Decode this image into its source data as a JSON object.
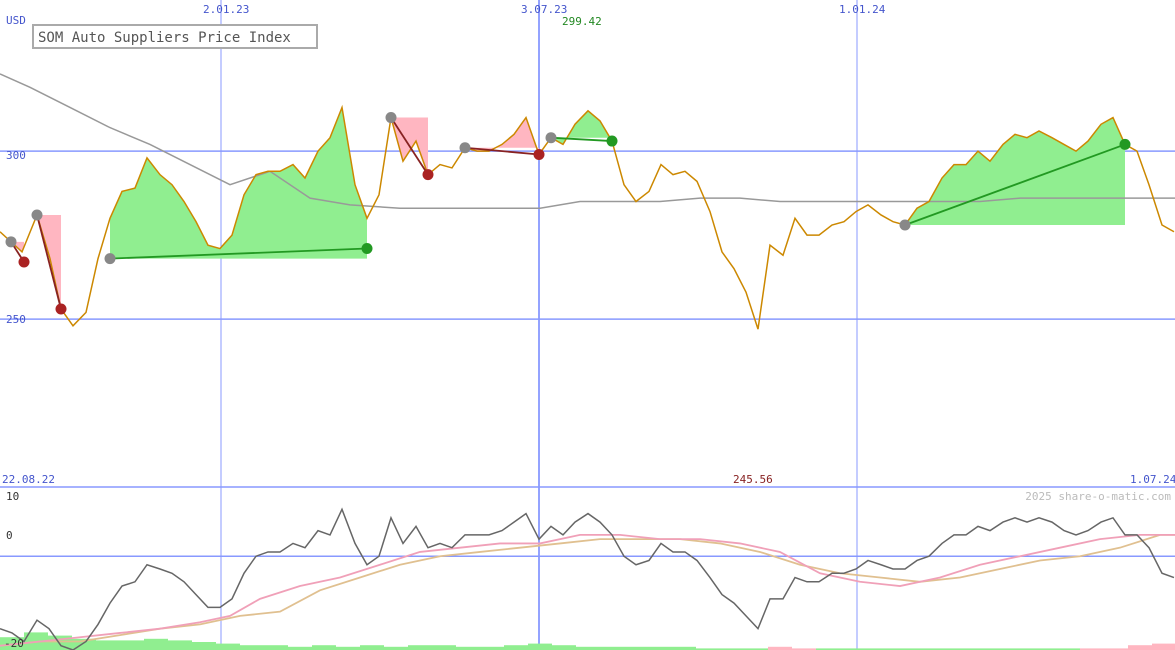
{
  "chart_data": [
    {
      "type": "line",
      "title": "SOM Auto Suppliers Price Index",
      "ylabel": "USD",
      "ylim": [
        200,
        345
      ],
      "y_ticks": [
        "300",
        "250"
      ],
      "x_ticks": [
        "2.01.23",
        "3.07.23",
        "1.01.24"
      ],
      "x_start_label": "22.08.22",
      "x_end_label": "1.07.24",
      "high_label": "299.42",
      "low_label": "245.56",
      "grid": true,
      "colors": {
        "price": "#cc8800",
        "average": "#999999",
        "gain_fill": "#90ee90",
        "loss_fill": "#ffb6c1",
        "gain_line": "#229922",
        "loss_line": "#882222",
        "grid": "#8899ff"
      },
      "price_series": [
        [
          0,
          276
        ],
        [
          11,
          273
        ],
        [
          22,
          270
        ],
        [
          37,
          281
        ],
        [
          50,
          268
        ],
        [
          61,
          253
        ],
        [
          73,
          248
        ],
        [
          86,
          252
        ],
        [
          98,
          268
        ],
        [
          110,
          280
        ],
        [
          122,
          288
        ],
        [
          135,
          289
        ],
        [
          147,
          298
        ],
        [
          160,
          293
        ],
        [
          172,
          290
        ],
        [
          184,
          285
        ],
        [
          196,
          279
        ],
        [
          208,
          272
        ],
        [
          220,
          271
        ],
        [
          232,
          275
        ],
        [
          244,
          287
        ],
        [
          256,
          293
        ],
        [
          268,
          294
        ],
        [
          280,
          294
        ],
        [
          293,
          296
        ],
        [
          305,
          292
        ],
        [
          318,
          300
        ],
        [
          330,
          304
        ],
        [
          342,
          313
        ],
        [
          355,
          290
        ],
        [
          367,
          280
        ],
        [
          379,
          287
        ],
        [
          391,
          310
        ],
        [
          403,
          297
        ],
        [
          416,
          303
        ],
        [
          428,
          293
        ],
        [
          440,
          296
        ],
        [
          452,
          295
        ],
        [
          465,
          301
        ],
        [
          477,
          300
        ],
        [
          489,
          300
        ],
        [
          502,
          302
        ],
        [
          514,
          305
        ],
        [
          526,
          310
        ],
        [
          539,
          299
        ],
        [
          551,
          304
        ],
        [
          563,
          302
        ],
        [
          575,
          308
        ],
        [
          588,
          312
        ],
        [
          600,
          309
        ],
        [
          612,
          303
        ],
        [
          624,
          290
        ],
        [
          636,
          285
        ],
        [
          649,
          288
        ],
        [
          661,
          296
        ],
        [
          673,
          293
        ],
        [
          685,
          294
        ],
        [
          697,
          291
        ],
        [
          710,
          282
        ],
        [
          722,
          270
        ],
        [
          734,
          265
        ],
        [
          746,
          258
        ],
        [
          758,
          247
        ],
        [
          770,
          272
        ],
        [
          783,
          269
        ],
        [
          795,
          280
        ],
        [
          807,
          275
        ],
        [
          819,
          275
        ],
        [
          832,
          278
        ],
        [
          844,
          279
        ],
        [
          856,
          282
        ],
        [
          868,
          284
        ],
        [
          881,
          281
        ],
        [
          893,
          279
        ],
        [
          905,
          278
        ],
        [
          917,
          283
        ],
        [
          929,
          285
        ],
        [
          942,
          292
        ],
        [
          954,
          296
        ],
        [
          966,
          296
        ],
        [
          978,
          300
        ],
        [
          990,
          297
        ],
        [
          1003,
          302
        ],
        [
          1015,
          305
        ],
        [
          1027,
          304
        ],
        [
          1039,
          306
        ],
        [
          1052,
          304
        ],
        [
          1064,
          302
        ],
        [
          1076,
          300
        ],
        [
          1088,
          303
        ],
        [
          1101,
          308
        ],
        [
          1113,
          310
        ],
        [
          1125,
          302
        ],
        [
          1137,
          300
        ],
        [
          1149,
          290
        ],
        [
          1162,
          278
        ],
        [
          1174,
          276
        ]
      ],
      "average_series": [
        [
          0,
          323
        ],
        [
          30,
          319
        ],
        [
          70,
          313
        ],
        [
          110,
          307
        ],
        [
          150,
          302
        ],
        [
          190,
          296
        ],
        [
          230,
          290
        ],
        [
          270,
          294
        ],
        [
          310,
          286
        ],
        [
          350,
          284
        ],
        [
          400,
          283
        ],
        [
          450,
          283
        ],
        [
          500,
          283
        ],
        [
          540,
          283
        ],
        [
          580,
          285
        ],
        [
          620,
          285
        ],
        [
          660,
          285
        ],
        [
          700,
          286
        ],
        [
          740,
          286
        ],
        [
          780,
          285
        ],
        [
          820,
          285
        ],
        [
          860,
          285
        ],
        [
          900,
          285
        ],
        [
          940,
          285
        ],
        [
          980,
          285
        ],
        [
          1020,
          286
        ],
        [
          1060,
          286
        ],
        [
          1100,
          286
        ],
        [
          1140,
          286
        ],
        [
          1175,
          286
        ]
      ],
      "trades": [
        {
          "result": "loss",
          "x1": 11,
          "y1": 273,
          "x2": 24,
          "y2": 267
        },
        {
          "result": "loss",
          "x1": 37,
          "y1": 281,
          "x2": 61,
          "y2": 253
        },
        {
          "result": "gain",
          "x1": 110,
          "y1": 268,
          "x2": 367,
          "y2": 271
        },
        {
          "result": "loss",
          "x1": 391,
          "y1": 310,
          "x2": 428,
          "y2": 293
        },
        {
          "result": "loss",
          "x1": 465,
          "y1": 301,
          "x2": 539,
          "y2": 299
        },
        {
          "result": "gain",
          "x1": 551,
          "y1": 304,
          "x2": 612,
          "y2": 303
        },
        {
          "result": "gain",
          "x1": 905,
          "y1": 278,
          "x2": 1125,
          "y2": 302
        }
      ]
    },
    {
      "type": "line",
      "title": "",
      "ylim": [
        -22,
        16
      ],
      "y_ticks": [
        "10",
        "0",
        "-20"
      ],
      "watermark": "2025 share-o-matic.com",
      "colors": {
        "momentum": "#666666",
        "fast": "#f0a0b8",
        "slow": "#e0c090",
        "pos_bar": "#90ee90",
        "neg_bar": "#ffb6c1"
      },
      "momentum": [
        [
          0,
          -17
        ],
        [
          12,
          -18
        ],
        [
          24,
          -20
        ],
        [
          37,
          -15
        ],
        [
          49,
          -17
        ],
        [
          61,
          -21
        ],
        [
          73,
          -22
        ],
        [
          86,
          -20
        ],
        [
          98,
          -16
        ],
        [
          110,
          -11
        ],
        [
          122,
          -7
        ],
        [
          135,
          -6
        ],
        [
          147,
          -2
        ],
        [
          160,
          -3
        ],
        [
          172,
          -4
        ],
        [
          184,
          -6
        ],
        [
          196,
          -9
        ],
        [
          208,
          -12
        ],
        [
          220,
          -12
        ],
        [
          232,
          -10
        ],
        [
          244,
          -4
        ],
        [
          256,
          0
        ],
        [
          268,
          1
        ],
        [
          280,
          1
        ],
        [
          293,
          3
        ],
        [
          305,
          2
        ],
        [
          318,
          6
        ],
        [
          330,
          5
        ],
        [
          342,
          11
        ],
        [
          355,
          3
        ],
        [
          367,
          -2
        ],
        [
          379,
          0
        ],
        [
          391,
          9
        ],
        [
          403,
          3
        ],
        [
          416,
          7
        ],
        [
          428,
          2
        ],
        [
          440,
          3
        ],
        [
          452,
          2
        ],
        [
          465,
          5
        ],
        [
          477,
          5
        ],
        [
          489,
          5
        ],
        [
          502,
          6
        ],
        [
          514,
          8
        ],
        [
          526,
          10
        ],
        [
          539,
          4
        ],
        [
          551,
          7
        ],
        [
          563,
          5
        ],
        [
          575,
          8
        ],
        [
          588,
          10
        ],
        [
          600,
          8
        ],
        [
          612,
          5
        ],
        [
          624,
          0
        ],
        [
          636,
          -2
        ],
        [
          649,
          -1
        ],
        [
          661,
          3
        ],
        [
          673,
          1
        ],
        [
          685,
          1
        ],
        [
          697,
          -1
        ],
        [
          710,
          -5
        ],
        [
          722,
          -9
        ],
        [
          734,
          -11
        ],
        [
          746,
          -14
        ],
        [
          758,
          -17
        ],
        [
          770,
          -10
        ],
        [
          783,
          -10
        ],
        [
          795,
          -5
        ],
        [
          807,
          -6
        ],
        [
          819,
          -6
        ],
        [
          832,
          -4
        ],
        [
          844,
          -4
        ],
        [
          856,
          -3
        ],
        [
          868,
          -1
        ],
        [
          881,
          -2
        ],
        [
          893,
          -3
        ],
        [
          905,
          -3
        ],
        [
          917,
          -1
        ],
        [
          929,
          0
        ],
        [
          942,
          3
        ],
        [
          954,
          5
        ],
        [
          966,
          5
        ],
        [
          978,
          7
        ],
        [
          990,
          6
        ],
        [
          1003,
          8
        ],
        [
          1015,
          9
        ],
        [
          1027,
          8
        ],
        [
          1039,
          9
        ],
        [
          1052,
          8
        ],
        [
          1064,
          6
        ],
        [
          1076,
          5
        ],
        [
          1088,
          6
        ],
        [
          1101,
          8
        ],
        [
          1113,
          9
        ],
        [
          1125,
          5
        ],
        [
          1137,
          5
        ],
        [
          1149,
          2
        ],
        [
          1162,
          -4
        ],
        [
          1174,
          -5
        ]
      ],
      "fast": [
        [
          0,
          -21
        ],
        [
          40,
          -20
        ],
        [
          80,
          -19
        ],
        [
          120,
          -18
        ],
        [
          160,
          -17
        ],
        [
          200,
          -15.5
        ],
        [
          230,
          -14
        ],
        [
          260,
          -10
        ],
        [
          300,
          -7
        ],
        [
          340,
          -5
        ],
        [
          380,
          -2
        ],
        [
          420,
          1
        ],
        [
          460,
          2
        ],
        [
          500,
          3
        ],
        [
          540,
          3
        ],
        [
          580,
          5
        ],
        [
          620,
          5
        ],
        [
          660,
          4
        ],
        [
          700,
          4
        ],
        [
          740,
          3
        ],
        [
          780,
          1
        ],
        [
          820,
          -4
        ],
        [
          860,
          -6
        ],
        [
          900,
          -7
        ],
        [
          940,
          -5
        ],
        [
          980,
          -2
        ],
        [
          1020,
          0
        ],
        [
          1060,
          2
        ],
        [
          1100,
          4
        ],
        [
          1140,
          5
        ],
        [
          1175,
          5
        ]
      ],
      "slow": [
        [
          0,
          -21
        ],
        [
          40,
          -20
        ],
        [
          80,
          -20
        ],
        [
          120,
          -18.5
        ],
        [
          160,
          -17
        ],
        [
          200,
          -16
        ],
        [
          240,
          -14
        ],
        [
          280,
          -13
        ],
        [
          320,
          -8
        ],
        [
          360,
          -5
        ],
        [
          400,
          -2
        ],
        [
          440,
          0
        ],
        [
          480,
          1
        ],
        [
          520,
          2
        ],
        [
          560,
          3
        ],
        [
          600,
          4
        ],
        [
          640,
          4
        ],
        [
          680,
          4
        ],
        [
          720,
          3
        ],
        [
          760,
          1
        ],
        [
          800,
          -2
        ],
        [
          840,
          -4
        ],
        [
          880,
          -5
        ],
        [
          920,
          -6
        ],
        [
          960,
          -5
        ],
        [
          1000,
          -3
        ],
        [
          1040,
          -1
        ],
        [
          1080,
          0
        ],
        [
          1120,
          2
        ],
        [
          1160,
          5
        ],
        [
          1175,
          5
        ]
      ],
      "bars": [
        [
          0,
          8
        ],
        [
          24,
          11
        ],
        [
          48,
          9
        ],
        [
          72,
          7
        ],
        [
          96,
          6
        ],
        [
          120,
          6
        ],
        [
          144,
          7
        ],
        [
          168,
          6
        ],
        [
          192,
          5
        ],
        [
          216,
          4
        ],
        [
          240,
          3
        ],
        [
          264,
          3
        ],
        [
          288,
          2
        ],
        [
          312,
          3
        ],
        [
          336,
          2
        ],
        [
          360,
          3
        ],
        [
          384,
          2
        ],
        [
          408,
          3
        ],
        [
          432,
          3
        ],
        [
          456,
          2
        ],
        [
          480,
          2
        ],
        [
          504,
          3
        ],
        [
          528,
          4
        ],
        [
          552,
          3
        ],
        [
          576,
          2
        ],
        [
          600,
          2
        ],
        [
          624,
          2
        ],
        [
          648,
          2
        ],
        [
          672,
          2
        ],
        [
          696,
          1
        ],
        [
          720,
          1
        ],
        [
          744,
          1
        ],
        [
          768,
          -2
        ],
        [
          792,
          -1
        ],
        [
          816,
          1
        ],
        [
          840,
          1
        ],
        [
          864,
          1
        ],
        [
          888,
          1
        ],
        [
          912,
          1
        ],
        [
          936,
          1
        ],
        [
          960,
          1
        ],
        [
          984,
          1
        ],
        [
          1008,
          1
        ],
        [
          1032,
          1
        ],
        [
          1056,
          1
        ],
        [
          1080,
          -1
        ],
        [
          1104,
          -1
        ],
        [
          1128,
          -3
        ],
        [
          1152,
          -4
        ]
      ]
    }
  ]
}
